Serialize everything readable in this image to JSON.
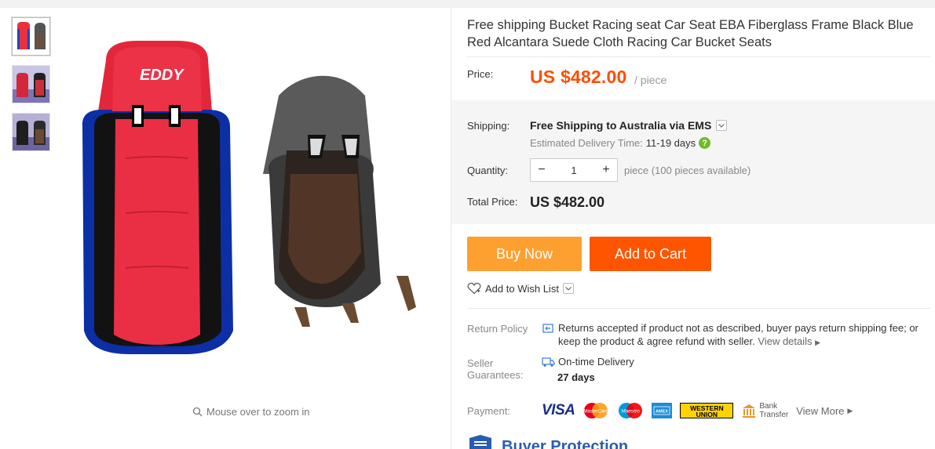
{
  "product": {
    "title": "Free shipping Bucket Racing seat Car Seat EBA Fiberglass Frame Black Blue Red Alcantara Suede Cloth Racing Car Bucket Seats",
    "image_brand_text": "EDDY"
  },
  "gallery": {
    "thumbnails": [
      "thumb-1",
      "thumb-2",
      "thumb-3"
    ],
    "zoom_hint": "Mouse over to zoom in"
  },
  "price": {
    "label": "Price:",
    "value": "US $482.00",
    "unit": "/ piece",
    "color": "#ff4e00"
  },
  "shipping": {
    "label": "Shipping:",
    "method": "Free Shipping to Australia via EMS",
    "est_label": "Estimated Delivery Time:",
    "est_value": "11-19 days"
  },
  "quantity": {
    "label": "Quantity:",
    "value": "1",
    "note": "piece (100 pieces available)"
  },
  "total": {
    "label": "Total Price:",
    "value": "US $482.00"
  },
  "actions": {
    "buy_now": "Buy Now",
    "add_to_cart": "Add to Cart",
    "wish_list": "Add to Wish List"
  },
  "return_policy": {
    "label": "Return Policy",
    "text": "Returns accepted if product not as described, buyer pays return shipping fee; or keep the product & agree refund with seller.",
    "link": "View details"
  },
  "guarantees": {
    "label_line1": "Seller",
    "label_line2": "Guarantees:",
    "item": "On-time Delivery",
    "days": "27 days"
  },
  "payment": {
    "label": "Payment:",
    "visa": "VISA",
    "mastercard": "MasterCard",
    "maestro": "Maestro",
    "amex": "AMEX",
    "western_union_line1": "WESTERN",
    "western_union_line2": "UNION",
    "bank_line1": "Bank",
    "bank_line2": "Transfer",
    "view_more": "View More"
  },
  "protection": {
    "title": "Buyer Protection"
  }
}
